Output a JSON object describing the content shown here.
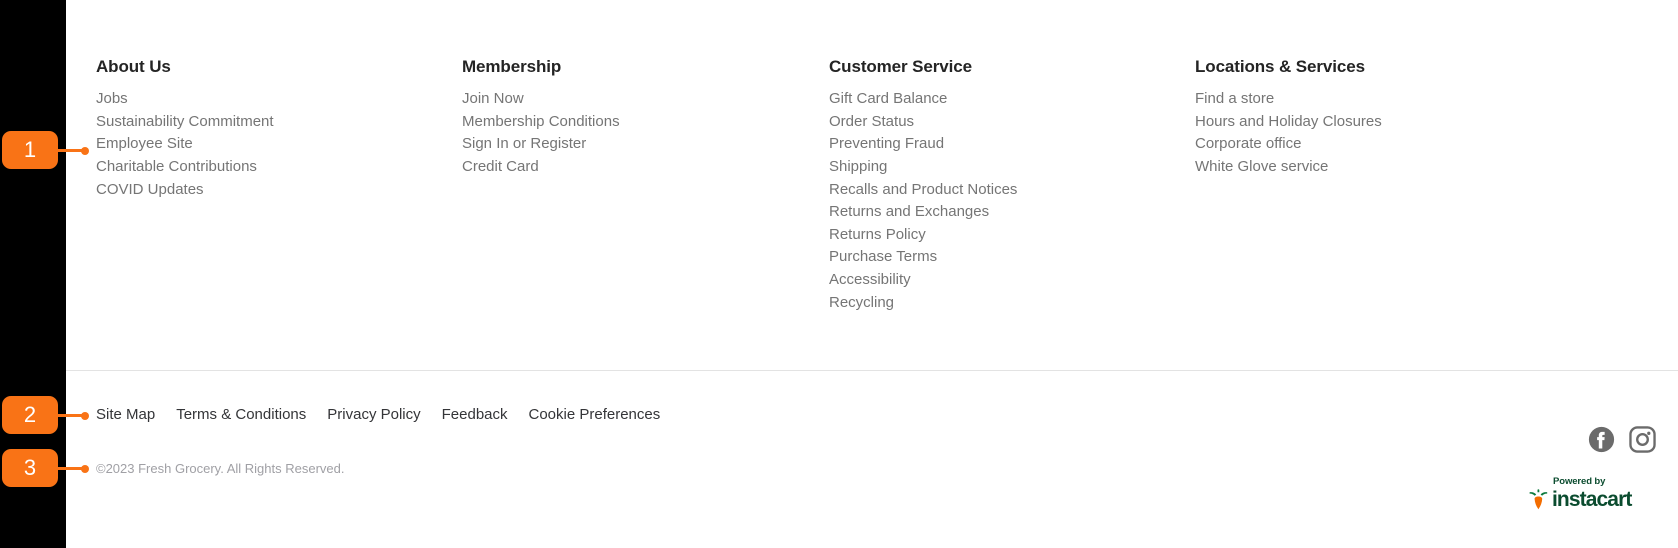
{
  "footer": {
    "columns": [
      {
        "title": "About Us",
        "links": [
          "Jobs",
          "Sustainability Commitment",
          "Employee Site",
          "Charitable Contributions",
          "COVID Updates"
        ]
      },
      {
        "title": "Membership",
        "links": [
          "Join Now",
          "Membership Conditions",
          "Sign In or Register",
          "Credit Card"
        ]
      },
      {
        "title": "Customer Service",
        "links": [
          "Gift Card Balance",
          "Order Status",
          "Preventing Fraud",
          "Shipping",
          "Recalls and Product Notices",
          "Returns and Exchanges",
          "Returns Policy",
          "Purchase Terms",
          "Accessibility",
          "Recycling"
        ]
      },
      {
        "title": "Locations & Services",
        "links": [
          "Find a store",
          "Hours and Holiday Closures",
          "Corporate office",
          "White Glove service"
        ]
      }
    ],
    "legal_links": [
      "Site Map",
      "Terms & Conditions",
      "Privacy Policy",
      "Feedback",
      "Cookie Preferences"
    ],
    "copyright": "©2023 Fresh Grocery. All Rights Reserved.",
    "social": [
      {
        "name": "facebook-icon",
        "label": "Facebook"
      },
      {
        "name": "instagram-icon",
        "label": "Instagram"
      }
    ],
    "attribution": {
      "powered_by": "Powered by",
      "brand": "instacart"
    }
  },
  "annotations": {
    "badges": [
      {
        "number": "1"
      },
      {
        "number": "2"
      },
      {
        "number": "3"
      }
    ]
  },
  "colors": {
    "accent": "#f97316",
    "rail": "#000000",
    "heading": "#242424",
    "link": "#757575",
    "legal_link": "#343538",
    "copyright": "#a0a0a5",
    "divider": "#e3e3e3",
    "instacart_green": "#0b4c2f",
    "carrot_orange": "#f36d00",
    "social_icon": "#6b6b6b"
  }
}
